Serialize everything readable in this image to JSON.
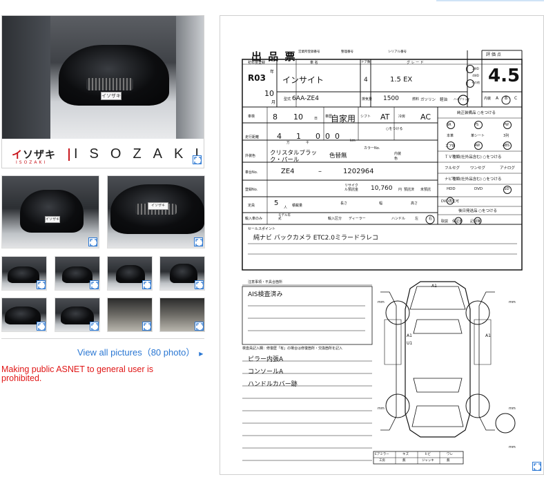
{
  "logo": {
    "katakana_red": "イ",
    "katakana_rest": "ソザキ",
    "sub": "ISOZAKI",
    "wordmark": "ISOZAKI"
  },
  "gallery": {
    "view_all_label": "View all pictures（80 photo）",
    "warning": "Making public ASNET to general user is prohibited.",
    "plate_text": "イソザキ"
  },
  "sheet": {
    "title": "出 品 票",
    "header_small": [
      "営業所登録番号",
      "整理番号",
      "シリアル番号"
    ],
    "reg_year_label": "初年度登録",
    "reg_year": "R03",
    "reg_month": "10",
    "month_unit": "年",
    "month_unit2": "月",
    "car_name_label": "車 名",
    "car_name": "インサイト",
    "door_label": "ドア数",
    "doors": "4",
    "grade_label": "グ レ ー ド",
    "grade": "1.5 EX",
    "type_label": "型式",
    "model_code": "6AA-ZE4",
    "displacement_label": "排気量",
    "displacement": "1500",
    "fuel_label": "燃料",
    "fuel_options": [
      "ガソリン",
      "軽油",
      "ハイブリッド"
    ],
    "score_label": "評 価 点",
    "score": "4.5",
    "interior_label": "内装",
    "interior_options": [
      "A",
      "B",
      "C"
    ],
    "drive_options": [
      "2WD",
      "4WD",
      "その他"
    ],
    "inspection_label": "車検",
    "insp_year": "8",
    "insp_month": "10",
    "insp_day_unit": "日",
    "usage_label": "車歴",
    "usage": "自家用",
    "shift_label": "シフト",
    "shift": "AT",
    "ac_label": "冷房",
    "ac": "AC",
    "mileage_label": "走行距離",
    "mileage_digits": [
      "4",
      "1",
      "0",
      "0",
      "0"
    ],
    "mileage_unit": "km",
    "mileage_small": [
      "万",
      "千"
    ],
    "circle_note": "○をつける",
    "color_label": "外装色",
    "color": "クリスタルブラック・パール",
    "color_change_label": "色替無",
    "color_no_label": "カラーNo.",
    "int_color_label": "内装色",
    "chassis_label": "車台No.",
    "chassis_prefix": "ZE4",
    "chassis_dash": "–",
    "chassis_num": "1202964",
    "reg_no_label": "登録No.",
    "recycle_label": "リサイクル預託金",
    "recycle": "10,760",
    "recycle_unit": "円",
    "recycle_deposit": "預託済",
    "recycle_not": "未預託",
    "capacity_label": "定員",
    "capacity": "5",
    "capacity_unit": "人",
    "load_label": "積載量",
    "dims_labels": [
      "長さ",
      "幅",
      "高さ"
    ],
    "import_label": "輸入車のみ",
    "model_year_label": "モデル年式",
    "import_div_label": "輸入区分",
    "dealer_label": "ディーラー",
    "hand_label": "ハンドル",
    "hand_options": [
      "左",
      "右"
    ],
    "equip_label": "純正装備品 ○をつける",
    "equip_items": [
      "SR",
      "PS",
      "PW",
      "本革",
      "革シート",
      "3列",
      "エアB",
      "ABS",
      "AW",
      "ナビ"
    ],
    "tv_label": "ＴＶ種類(社外品含む) ○をつける",
    "tv_items": [
      "フルセグ",
      "ワンセグ",
      "アナログ"
    ],
    "navi_label": "ナビ種類(社外品含む) ○をつける",
    "navi_items": [
      "HDD",
      "DVD",
      "SD",
      "DVD再生可"
    ],
    "extras_label": "後日発送品 ○をつける",
    "extras_items": [
      "取説",
      "保証書",
      "記録簿"
    ],
    "sales_point_label": "セールスポイント",
    "sales_point": "純ナビ バックカメラ ETC2.0ミラードラレコ",
    "notes_label": "注意事項・不具合箇所",
    "notes": "AIS検査済み",
    "inspector_label": "検査員記入欄：修復歴「有」の場合は修復箇所・交換箇所を記入",
    "inspector_lines": [
      "ピラー内張A",
      "コンソールA",
      "ハンドルカバー跡"
    ],
    "diagram_marks": [
      "A1",
      "A1",
      "U1",
      "A1"
    ],
    "mm_label": "mm",
    "legend_headers": [
      "Eアミラー",
      "キズ",
      "ヒビ",
      "ワレ"
    ],
    "legend_values": [
      "工房",
      "無",
      "ジャッキ",
      "無"
    ]
  }
}
